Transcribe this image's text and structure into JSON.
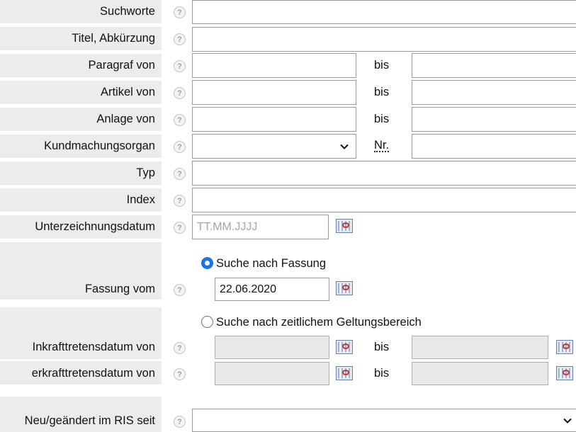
{
  "fields": {
    "suchworte": {
      "label": "Suchworte",
      "value": ""
    },
    "titel": {
      "label": "Titel, Abkürzung",
      "value": ""
    },
    "paragraf": {
      "label": "Paragraf von",
      "bis_label": "bis"
    },
    "artikel": {
      "label": "Artikel von",
      "bis_label": "bis"
    },
    "anlage": {
      "label": "Anlage von",
      "bis_label": "bis"
    },
    "kundmachungsorgan": {
      "label": "Kundmachungsorgan",
      "selected": "",
      "nr_label": "Nr."
    },
    "typ": {
      "label": "Typ",
      "value": ""
    },
    "index": {
      "label": "Index",
      "value": ""
    },
    "unterzeichnungsdatum": {
      "label": "Unterzeichnungsdatum",
      "placeholder": "TT.MM.JJJJ"
    },
    "fassung": {
      "radio_label": "Suche nach Fassung",
      "radio_checked": true,
      "label": "Fassung vom",
      "value": "22.06.2020"
    },
    "geltung": {
      "radio_label": "Suche nach zeitlichem Geltungsbereich",
      "radio_checked": false
    },
    "inkraft": {
      "label": "Inkrafttretensdatum von",
      "bis_label": "bis"
    },
    "ausserkraft": {
      "label": "erkrafttretensdatum von",
      "bis_label": "bis"
    },
    "neu": {
      "label": "Neu/geändert im RIS seit",
      "selected": ""
    }
  },
  "help_symbol": "?",
  "icons": {
    "help": "help-icon",
    "calendar": "calendar-icon",
    "dropdown": "chevron-down-icon"
  }
}
